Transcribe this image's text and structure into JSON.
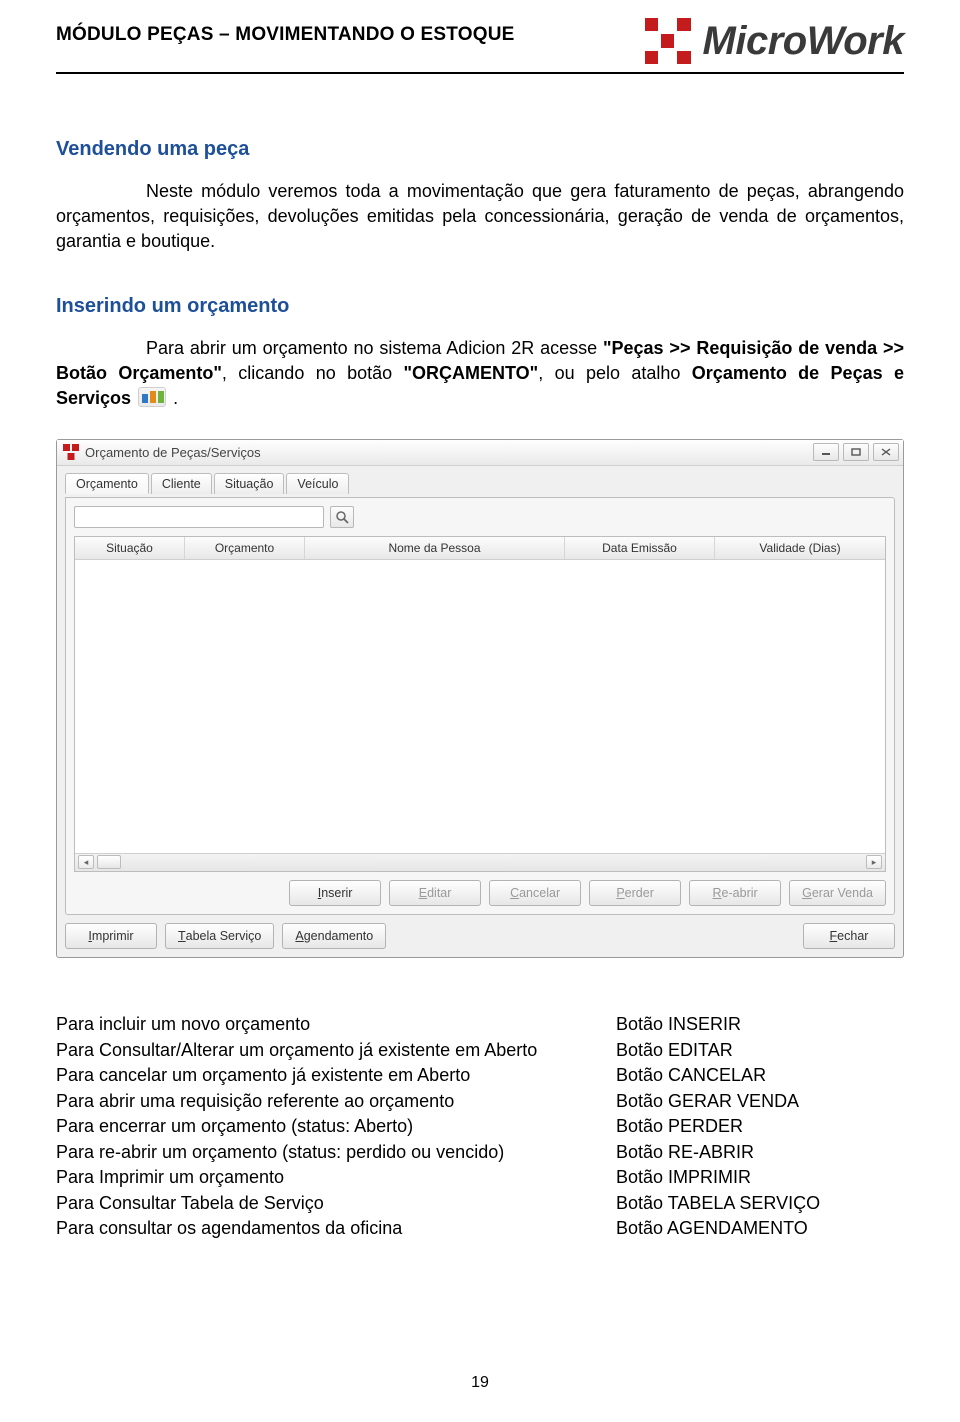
{
  "doc": {
    "header_title": "MÓDULO PEÇAS – MOVIMENTANDO O ESTOQUE",
    "brand": "MicroWork",
    "page_number": "19"
  },
  "section1": {
    "title": "Vendendo uma peça",
    "paragraph": "Neste módulo veremos toda a movimentação que gera faturamento de peças, abrangendo orçamentos, requisições, devoluções emitidas pela concessionária, geração de venda de orçamentos, garantia e boutique."
  },
  "section2": {
    "title": "Inserindo um orçamento",
    "run1": "Para abrir um orçamento no sistema Adicion 2R acesse ",
    "run2_bold": "\"Peças >> Requisição de venda >> Botão Orçamento\"",
    "run3": ", clicando no botão ",
    "run4_bold": "\"ORÇAMENTO\"",
    "run5": ", ou pelo atalho ",
    "run6_bold": "Orçamento de Peças e Serviços",
    "run7": " ."
  },
  "window": {
    "title": "Orçamento de Peças/Serviços",
    "tabs": [
      "Orçamento",
      "Cliente",
      "Situação",
      "Veículo"
    ],
    "grid_headers": [
      "Situação",
      "Orçamento",
      "Nome da Pessoa",
      "Data Emissão",
      "Validade (Dias)"
    ],
    "buttons_row1": [
      {
        "label": "Inserir",
        "m": "I",
        "enabled": true
      },
      {
        "label": "Editar",
        "m": "E",
        "enabled": false
      },
      {
        "label": "Cancelar",
        "m": "C",
        "enabled": false
      },
      {
        "label": "Perder",
        "m": "P",
        "enabled": false
      },
      {
        "label": "Re-abrir",
        "m": "R",
        "enabled": false
      },
      {
        "label": "Gerar Venda",
        "m": "G",
        "enabled": false
      }
    ],
    "buttons_row2_left": [
      {
        "label": "Imprimir",
        "m": "I"
      },
      {
        "label": "Tabela Serviço",
        "m": "T"
      },
      {
        "label": "Agendamento",
        "m": "A"
      }
    ],
    "buttons_row2_right": [
      {
        "label": "Fechar",
        "m": "F"
      }
    ]
  },
  "actions": [
    {
      "left": "Para incluir um novo orçamento",
      "right": "Botão INSERIR"
    },
    {
      "left": "Para Consultar/Alterar um orçamento já existente em Aberto",
      "right": "Botão EDITAR"
    },
    {
      "left": "Para cancelar um orçamento já existente em Aberto",
      "right": "Botão CANCELAR"
    },
    {
      "left": "Para abrir uma requisição referente ao orçamento",
      "right": "Botão GERAR VENDA"
    },
    {
      "left": "Para encerrar um orçamento (status: Aberto)",
      "right": "Botão PERDER"
    },
    {
      "left": "Para re-abrir um orçamento  (status: perdido ou vencido)",
      "right": "Botão RE-ABRIR"
    },
    {
      "left": "Para Imprimir um orçamento",
      "right": "Botão IMPRIMIR"
    },
    {
      "left": "Para Consultar Tabela de Serviço",
      "right": "Botão TABELA SERVIÇO"
    },
    {
      "left": "Para consultar os agendamentos da oficina",
      "right": "Botão AGENDAMENTO"
    }
  ]
}
